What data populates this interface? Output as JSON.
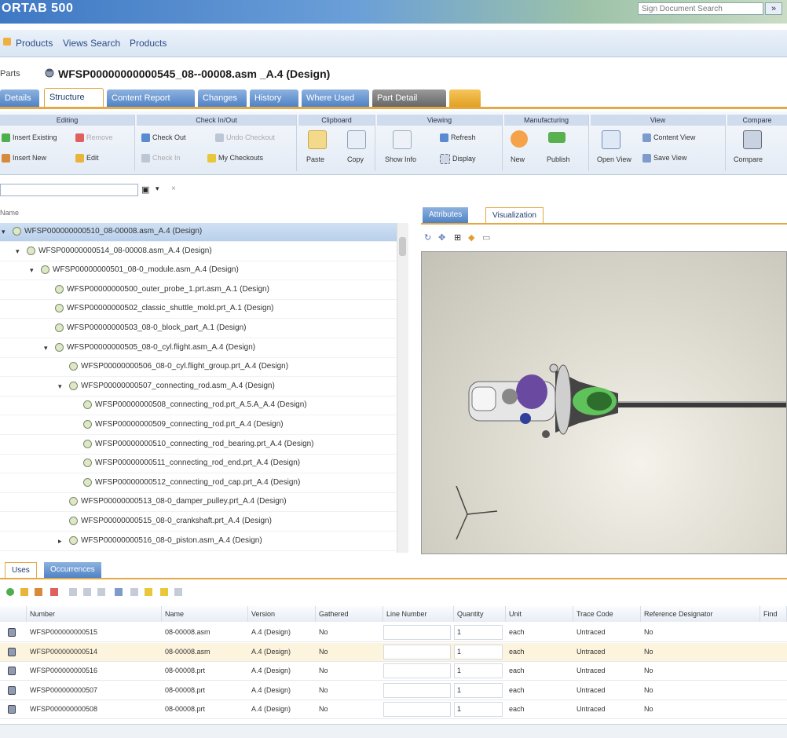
{
  "app": {
    "title": "ORTAB 500",
    "search_placeholder": "Sign Document Search",
    "search_btn": "»"
  },
  "nav": {
    "links": [
      "Products",
      "Views Search",
      "Products"
    ]
  },
  "object": {
    "type": "Parts",
    "title": "WFSP00000000000545_08--00008.asm _A.4 (Design)"
  },
  "tabs": [
    {
      "label": "Details",
      "active": false,
      "dark": false
    },
    {
      "label": "Structure",
      "active": true,
      "dark": false
    },
    {
      "label": "Content Report",
      "active": false,
      "dark": false
    },
    {
      "label": "Changes",
      "active": false,
      "dark": false
    },
    {
      "label": "History",
      "active": false,
      "dark": false
    },
    {
      "label": "Where Used",
      "active": false,
      "dark": false
    },
    {
      "label": "Part Detail",
      "active": false,
      "dark": true
    }
  ],
  "ribbon": {
    "groups": [
      {
        "title": "Editing",
        "items": [
          "Insert Existing",
          "Remove",
          "Insert New",
          "Edit"
        ]
      },
      {
        "title": "Check In/Out",
        "items": [
          "Check Out",
          "Undo Checkout",
          "Check In",
          "My Checkouts"
        ]
      },
      {
        "title": "Clipboard",
        "items": [
          "Paste",
          "Copy"
        ]
      },
      {
        "title": "Viewing",
        "items": [
          "Show Info",
          "Refresh",
          "Display"
        ]
      },
      {
        "title": "Manufacturing",
        "items": [
          "New",
          "Publish"
        ]
      },
      {
        "title": "View",
        "items": [
          "Open View",
          "Content View",
          "Save View"
        ]
      },
      {
        "title": "Compare",
        "items": [
          "Compare"
        ]
      }
    ]
  },
  "filter": {
    "placeholder": ""
  },
  "left_panel": {
    "header": "Name"
  },
  "tree": [
    {
      "label": "WFSP000000000510_08-00008.asm_A.4 (Design)",
      "indent": 0,
      "icon": "assembly",
      "expander": "▾",
      "selected": true
    },
    {
      "label": "WFSP00000000514_08-00008.asm_A.4 (Design)",
      "indent": 1,
      "icon": "assembly",
      "expander": "▾",
      "selected": false
    },
    {
      "label": "WFSP00000000501_08-0_module.asm_A.4 (Design)",
      "indent": 2,
      "icon": "assembly",
      "expander": "▾",
      "selected": false
    },
    {
      "label": "WFSP00000000500_outer_probe_1.prt.asm_A.1 (Design)",
      "indent": 3,
      "icon": "part",
      "expander": "",
      "selected": false
    },
    {
      "label": "WFSP00000000502_classic_shuttle_mold.prt_A.1 (Design)",
      "indent": 3,
      "icon": "part",
      "expander": "",
      "selected": false
    },
    {
      "label": "WFSP00000000503_08-0_block_part_A.1 (Design)",
      "indent": 3,
      "icon": "part",
      "expander": "",
      "selected": false
    },
    {
      "label": "WFSP00000000505_08-0_cyl.flight.asm_A.4 (Design)",
      "indent": 3,
      "icon": "assembly",
      "expander": "▾",
      "selected": false
    },
    {
      "label": "WFSP00000000506_08-0_cyl.flight_group.prt_A.4 (Design)",
      "indent": 4,
      "icon": "part",
      "expander": "",
      "selected": false
    },
    {
      "label": "WFSP00000000507_connecting_rod.asm_A.4 (Design)",
      "indent": 4,
      "icon": "assembly",
      "expander": "▾",
      "selected": false
    },
    {
      "label": "WFSP00000000508_connecting_rod.prt_A.5.A_A.4 (Design)",
      "indent": 5,
      "icon": "part",
      "expander": "",
      "selected": false
    },
    {
      "label": "WFSP00000000509_connecting_rod.prt_A.4 (Design)",
      "indent": 5,
      "icon": "part",
      "expander": "",
      "selected": false
    },
    {
      "label": "WFSP00000000510_connecting_rod_bearing.prt_A.4 (Design)",
      "indent": 5,
      "icon": "part",
      "expander": "",
      "selected": false
    },
    {
      "label": "WFSP00000000511_connecting_rod_end.prt_A.4 (Design)",
      "indent": 5,
      "icon": "part",
      "expander": "",
      "selected": false
    },
    {
      "label": "WFSP00000000512_connecting_rod_cap.prt_A.4 (Design)",
      "indent": 5,
      "icon": "part",
      "expander": "",
      "selected": false
    },
    {
      "label": "WFSP00000000513_08-0_damper_pulley.prt_A.4 (Design)",
      "indent": 4,
      "icon": "part",
      "expander": "",
      "selected": false
    },
    {
      "label": "WFSP00000000515_08-0_crankshaft.prt_A.4 (Design)",
      "indent": 4,
      "icon": "part",
      "expander": "",
      "selected": false
    },
    {
      "label": "WFSP00000000516_08-0_piston.asm_A.4 (Design)",
      "indent": 4,
      "icon": "assembly",
      "expander": "▸",
      "selected": false
    }
  ],
  "right_panel": {
    "tabs": [
      {
        "label": "Attributes",
        "active": false
      },
      {
        "label": "Visualization",
        "active": true
      }
    ]
  },
  "bottom": {
    "tabs": [
      {
        "label": "Uses",
        "active": true
      },
      {
        "label": "Occurrences",
        "active": false
      }
    ],
    "columns": [
      "Number",
      "Name",
      "Version",
      "Gathered",
      "Line Number",
      "Quantity",
      "Unit",
      "Trace Code",
      "Reference Designator",
      "Find"
    ],
    "rows": [
      [
        "WFSP000000000515",
        "08-00008.asm",
        "A.4 (Design)",
        "No",
        "",
        "1",
        "each",
        "Untraced",
        "No",
        ""
      ],
      [
        "WFSP000000000514",
        "08-00008.asm",
        "A.4 (Design)",
        "No",
        "",
        "1",
        "each",
        "Untraced",
        "No",
        ""
      ],
      [
        "WFSP000000000516",
        "08-00008.prt",
        "A.4 (Design)",
        "No",
        "",
        "1",
        "each",
        "Untraced",
        "No",
        ""
      ],
      [
        "WFSP000000000507",
        "08-00008.prt",
        "A.4 (Design)",
        "No",
        "",
        "1",
        "each",
        "Untraced",
        "No",
        ""
      ],
      [
        "WFSP000000000508",
        "08-00008.prt",
        "A.4 (Design)",
        "No",
        "",
        "1",
        "each",
        "Untraced",
        "No",
        ""
      ]
    ]
  },
  "colors": {
    "accent_orange": "#e4a844",
    "tab_blue": "#4f82c6",
    "header_blue": "#3f78c4",
    "row_highlight": "#fdf4dd"
  }
}
